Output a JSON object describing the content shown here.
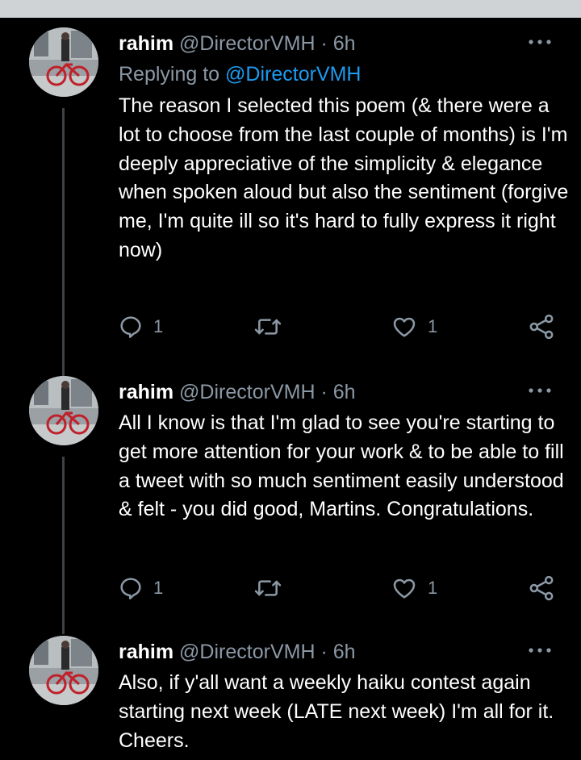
{
  "tweets": [
    {
      "name": "rahim",
      "handle": "@DirectorVMH",
      "separator": "·",
      "time": "6h",
      "replying_prefix": "Replying to",
      "replying_to": "@DirectorVMH",
      "text": "The reason I selected this poem (& there were a lot to choose from the last couple of months) is I'm deeply appreciative of the simplicity & elegance when spoken aloud but also the sentiment (forgive me, I'm quite ill so it's hard to fully express it right now)",
      "reply_count": "1",
      "like_count": "1"
    },
    {
      "name": "rahim",
      "handle": "@DirectorVMH",
      "separator": "·",
      "time": "6h",
      "text": "All I know is that I'm glad to see you're starting to get more attention for your work & to be able to fill a tweet with so much sentiment easily understood & felt - you did good, Martins. Congratulations.",
      "reply_count": "1",
      "like_count": "1"
    },
    {
      "name": "rahim",
      "handle": "@DirectorVMH",
      "separator": "·",
      "time": "6h",
      "text": "Also, if y'all want a weekly haiku contest again starting next week (LATE next week) I'm all for it. Cheers."
    }
  ],
  "icons": {
    "reply": "reply-icon",
    "retweet": "retweet-icon",
    "like": "like-icon",
    "share": "share-icon",
    "more": "more-icon"
  },
  "colors": {
    "background": "#000000",
    "text": "#ffffff",
    "secondary": "#8b98a5",
    "mention": "#1d9bf0",
    "thread_line": "#3d4246",
    "top_strip": "#cfd3d6"
  }
}
